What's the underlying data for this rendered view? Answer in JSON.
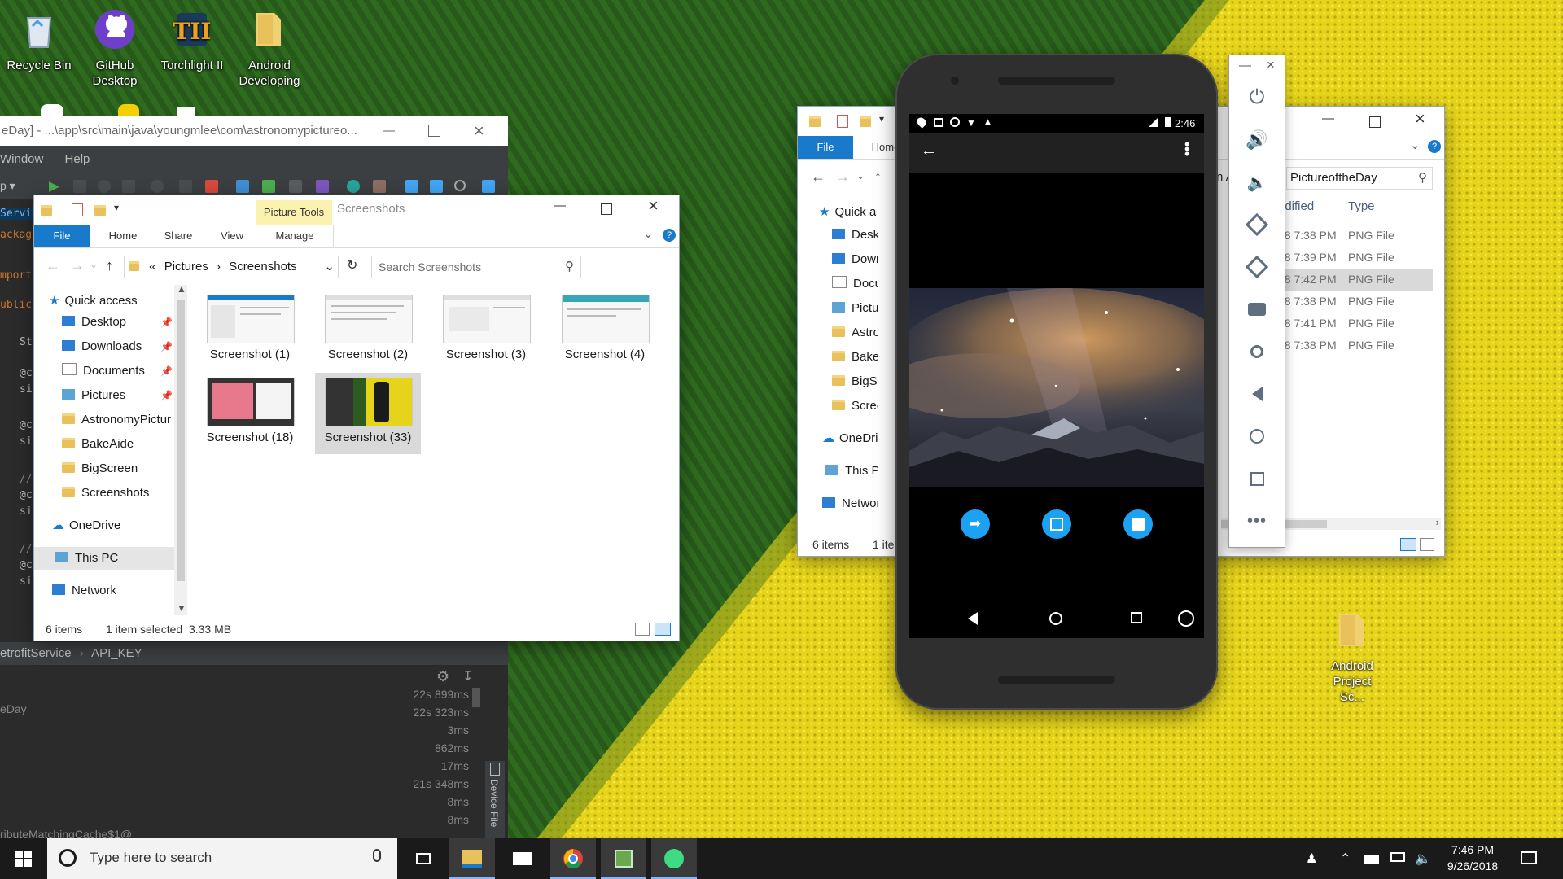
{
  "desktop": {
    "icons": [
      {
        "label": "Recycle Bin"
      },
      {
        "label": "GitHub Desktop"
      },
      {
        "label": "Torchlight II"
      },
      {
        "label": "Android Developing"
      },
      {
        "label": "Android Project Sc..."
      }
    ]
  },
  "ide": {
    "title": "eDay] - ...\\app\\src\\main\\java\\youngmlee\\com\\astronomypictureo...",
    "menu": [
      "Window",
      "Help"
    ],
    "code_fragments": [
      "Service",
      "ackag",
      "mport",
      "ublic",
      "St",
      "@c",
      "si",
      "@c",
      "si",
      "//",
      "@c",
      "si",
      "//",
      "@c",
      "si"
    ],
    "breadcrumb": [
      "etrofitService",
      "API_KEY"
    ],
    "log_left": [
      "eDay",
      "ributeMatchingCache$1@"
    ],
    "log_times": [
      "22s 899ms",
      "22s 323ms",
      "3ms",
      "862ms",
      "17ms",
      "21s 348ms",
      "8ms",
      "8ms"
    ],
    "side_tab": "Device File"
  },
  "explorer": {
    "context_tab": "Picture Tools",
    "title": "Screenshots",
    "tabs": [
      "File",
      "Home",
      "Share",
      "View",
      "Manage"
    ],
    "path": [
      "«",
      "Pictures",
      "Screenshots"
    ],
    "search_placeholder": "Search Screenshots",
    "nav": [
      {
        "label": "Quick access",
        "pinned": false
      },
      {
        "label": "Desktop",
        "pinned": true
      },
      {
        "label": "Downloads",
        "pinned": true
      },
      {
        "label": "Documents",
        "pinned": true
      },
      {
        "label": "Pictures",
        "pinned": true
      },
      {
        "label": "AstronomyPictur",
        "pinned": false
      },
      {
        "label": "BakeAide",
        "pinned": false
      },
      {
        "label": "BigScreen",
        "pinned": false
      },
      {
        "label": "Screenshots",
        "pinned": false
      },
      {
        "label": "OneDrive",
        "pinned": false
      },
      {
        "label": "This PC",
        "pinned": false
      },
      {
        "label": "Network",
        "pinned": false
      }
    ],
    "files": [
      {
        "name": "Screenshot (1)",
        "selected": false
      },
      {
        "name": "Screenshot (2)",
        "selected": false
      },
      {
        "name": "Screenshot (3)",
        "selected": false
      },
      {
        "name": "Screenshot (4)",
        "selected": false
      },
      {
        "name": "Screenshot (18)",
        "selected": false
      },
      {
        "name": "Screenshot (33)",
        "selected": true
      }
    ],
    "status": {
      "count": "6 items",
      "selection": "1 item selected  3.33 MB"
    }
  },
  "explorer2": {
    "tabs": [
      "File",
      "Home"
    ],
    "search_value": "PictureoftheDay",
    "nav": [
      "Quick acce",
      "Desktop",
      "Downloa",
      "Docume",
      "Pictures",
      "Astronor",
      "BakeAid",
      "BigScree",
      "Screensh",
      "OneDrive",
      "This PC",
      "Network"
    ],
    "columns": [
      "odified",
      "Type"
    ],
    "rows": [
      {
        "modified": "18 7:38 PM",
        "type": "PNG File",
        "selected": false
      },
      {
        "modified": "18 7:39 PM",
        "type": "PNG File",
        "selected": false
      },
      {
        "modified": "18 7:42 PM",
        "type": "PNG File",
        "selected": true
      },
      {
        "modified": "18 7:38 PM",
        "type": "PNG File",
        "selected": false
      },
      {
        "modified": "18 7:41 PM",
        "type": "PNG File",
        "selected": false
      },
      {
        "modified": "18 7:38 PM",
        "type": "PNG File",
        "selected": false
      }
    ],
    "status": {
      "count": "6 items",
      "selection": "1 ite"
    },
    "partial_path": "n A"
  },
  "phone": {
    "clock": "2:46",
    "accent": "#1da1f2"
  },
  "taskbar": {
    "search_placeholder": "Type here to search",
    "time": "7:46 PM",
    "date": "9/26/2018"
  }
}
